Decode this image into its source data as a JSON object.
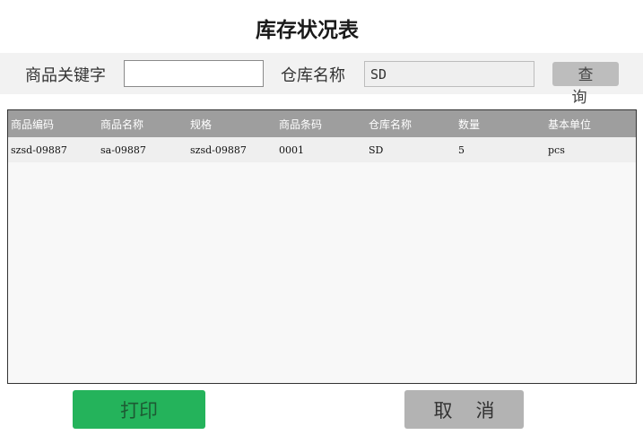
{
  "page": {
    "title": "库存状况表"
  },
  "search": {
    "keyword_label": "商品关键字",
    "keyword_value": "",
    "warehouse_label": "仓库名称",
    "warehouse_value": "SD",
    "query_button": "查询"
  },
  "table": {
    "columns": [
      "商品编码",
      "商品名称",
      "规格",
      "商品条码",
      "仓库名称",
      "数量",
      "基本单位"
    ],
    "rows": [
      [
        "szsd-09887",
        "sa-09887",
        "szsd-09887",
        "0001",
        "SD",
        "5",
        "pcs"
      ]
    ]
  },
  "actions": {
    "print_button": "打印",
    "cancel_button": "取消"
  },
  "colors": {
    "print_bg": "#24b35b",
    "cancel_bg": "#b3b3b3",
    "header_bg": "#9e9e9e"
  }
}
